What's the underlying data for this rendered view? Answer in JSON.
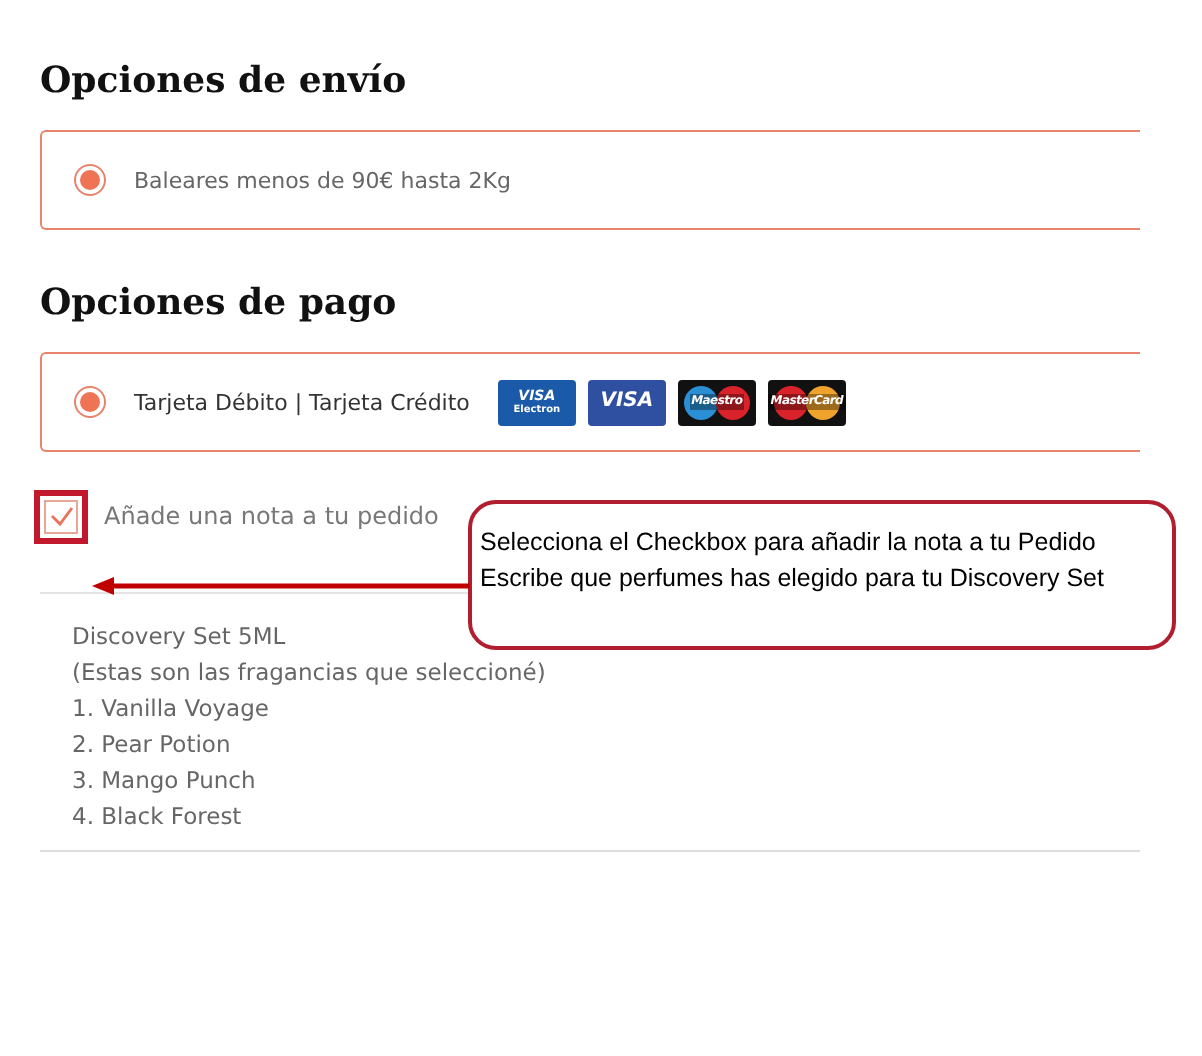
{
  "shipping": {
    "title": "Opciones de envío",
    "options": [
      {
        "label": "Baleares menos de 90€ hasta 2Kg",
        "selected": true
      }
    ]
  },
  "payment": {
    "title": "Opciones de pago",
    "options": [
      {
        "label": "Tarjeta Débito | Tarjeta Crédito",
        "selected": true
      }
    ],
    "cards": [
      {
        "kind": "visa-electron",
        "text": "VISA",
        "subtext": "Electron"
      },
      {
        "kind": "visa",
        "text": "VISA"
      },
      {
        "kind": "maestro",
        "text": "Maestro"
      },
      {
        "kind": "mastercard",
        "text": "MasterCard"
      }
    ]
  },
  "note": {
    "checked": true,
    "label": "Añade una nota a tu pedido",
    "value": [
      "Discovery Set 5ML",
      "(Estas son las fragancias que seleccioné)",
      "1. Vanilla Voyage",
      "2. Pear Potion",
      "3. Mango Punch",
      "4. Black Forest"
    ]
  },
  "callout": {
    "lines": [
      "Selecciona el Checkbox para añadir la nota a tu Pedido",
      "Escribe que perfumes has elegido para tu Discovery Set"
    ]
  }
}
